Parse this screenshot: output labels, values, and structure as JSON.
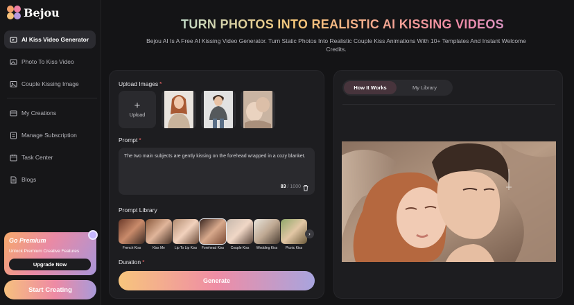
{
  "brand": {
    "name": "Bejou"
  },
  "nav": {
    "items": [
      {
        "label": "AI Kiss Video Generator",
        "icon": "film-sparkle-icon"
      },
      {
        "label": "Photo To Kiss Video",
        "icon": "photo-video-icon"
      },
      {
        "label": "Couple Kissing Image",
        "icon": "image-icon"
      },
      {
        "label": "My Creations",
        "icon": "creations-icon"
      },
      {
        "label": "Manage Subscription",
        "icon": "subscription-icon"
      },
      {
        "label": "Task Center",
        "icon": "calendar-icon"
      },
      {
        "label": "Blogs",
        "icon": "document-icon"
      }
    ]
  },
  "premium": {
    "title": "Go Premium",
    "subtitle": "Unlock Premium Creative Features",
    "button": "Upgrade Now"
  },
  "start_button": "Start Creating",
  "hero": {
    "title": "TURN PHOTOS INTO REALISTIC AI KISSING VIDEOS",
    "subtitle": "Bejou AI Is A Free AI Kissing Video Generator. Turn Static Photos Into Realistic Couple Kiss Animations With 10+ Templates And Instant Welcome Credits."
  },
  "form": {
    "upload_label": "Upload Images",
    "required_mark": "*",
    "upload_button": "Upload",
    "upload_plus": "+",
    "prompt_label": "Prompt",
    "prompt_text": "The two main subjects are gently kissing on the forehead wrapped in a cozy blanket.",
    "char_count": "83",
    "char_limit": "/ 1000",
    "library_label": "Prompt Library",
    "library": [
      "French Kiss",
      "Kiss Me",
      "Lip To Lip Kiss",
      "Forehead Kiss",
      "Couple Kiss",
      "Wedding Kiss",
      "Picnic Kiss"
    ],
    "library_next": "›",
    "duration_label": "Duration",
    "generate_button": "Generate"
  },
  "right": {
    "tabs": [
      "How It Works",
      "My Library"
    ]
  },
  "colors": {
    "background": "#141416",
    "panel": "#1d1d20",
    "accent_pink": "#ef8da5",
    "accent_orange": "#f7c57d",
    "accent_purple": "#a8a4de"
  }
}
